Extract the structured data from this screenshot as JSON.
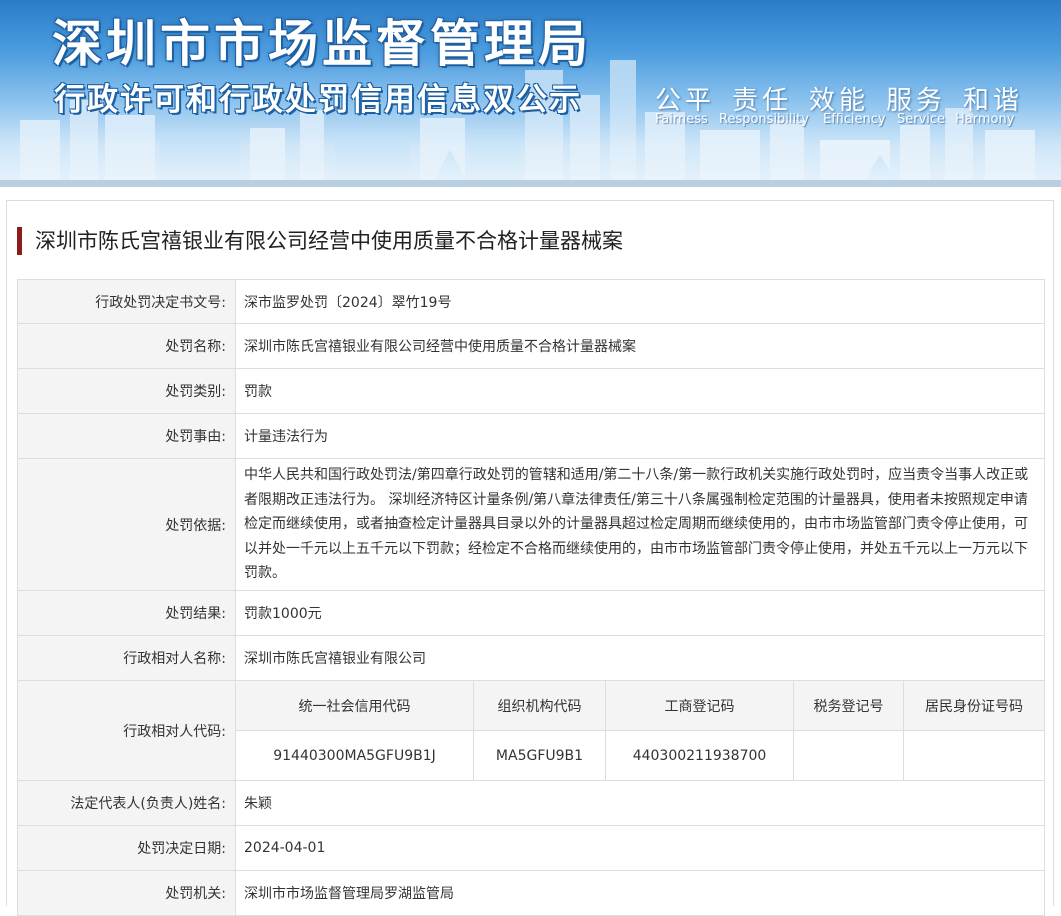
{
  "banner": {
    "title": "深圳市市场监督管理局",
    "subtitle": "行政许可和行政处罚信用信息双公示",
    "slogans": [
      {
        "cn": "公平",
        "en": "Fairness"
      },
      {
        "cn": "责任",
        "en": "Responsibility"
      },
      {
        "cn": "效能",
        "en": "Efficiency"
      },
      {
        "cn": "服务",
        "en": "Service"
      },
      {
        "cn": "和谐",
        "en": "Harmony"
      }
    ]
  },
  "case": {
    "title": "深圳市陈氏宫禧银业有限公司经营中使用质量不合格计量器械案",
    "accent_color": "#8b1c1c",
    "rows": {
      "doc_no": {
        "label": "行政处罚决定书文号:",
        "value": "深市监罗处罚〔2024〕翠竹19号"
      },
      "name": {
        "label": "处罚名称:",
        "value": "深圳市陈氏宫禧银业有限公司经营中使用质量不合格计量器械案"
      },
      "category": {
        "label": "处罚类别:",
        "value": "罚款"
      },
      "reason": {
        "label": "处罚事由:",
        "value": "计量违法行为"
      },
      "basis": {
        "label": "处罚依据:",
        "value": "中华人民共和国行政处罚法/第四章行政处罚的管辖和适用/第二十八条/第一款行政机关实施行政处罚时，应当责令当事人改正或者限期改正违法行为。 深圳经济特区计量条例/第八章法律责任/第三十八条属强制检定范围的计量器具，使用者未按照规定申请检定而继续使用，或者抽查检定计量器具目录以外的计量器具超过检定周期而继续使用的，由市市场监管部门责令停止使用，可以并处一千元以上五千元以下罚款；经检定不合格而继续使用的，由市市场监管部门责令停止使用，并处五千元以上一万元以下罚款。"
      },
      "result": {
        "label": "处罚结果:",
        "value": "罚款1000元"
      },
      "party_name": {
        "label": "行政相对人名称:",
        "value": "深圳市陈氏宫禧银业有限公司"
      },
      "party_code": {
        "label": "行政相对人代码:",
        "headers": [
          "统一社会信用代码",
          "组织机构代码",
          "工商登记码",
          "税务登记号",
          "居民身份证号码"
        ],
        "values": [
          "91440300MA5GFU9B1J",
          "MA5GFU9B1",
          "440300211938700",
          "",
          ""
        ]
      },
      "legal_rep": {
        "label": "法定代表人(负责人)姓名:",
        "value": "朱颖"
      },
      "decision_date": {
        "label": "处罚决定日期:",
        "value": "2024-04-01"
      },
      "authority": {
        "label": "处罚机关:",
        "value": "深圳市市场监督管理局罗湖监管局"
      }
    }
  }
}
